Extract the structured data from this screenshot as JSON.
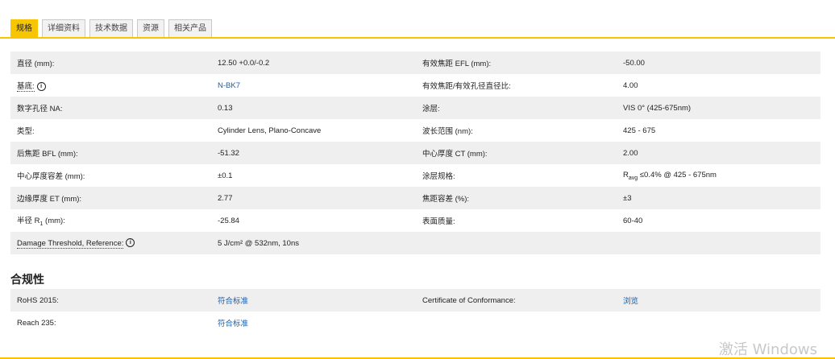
{
  "tabs": [
    "规格",
    "详细资料",
    "技术数据",
    "资源",
    "相关产品"
  ],
  "specs": [
    {
      "l1": "直径 (mm):",
      "v1": "12.50 +0.0/-0.2",
      "l2": "有效焦距 EFL (mm):",
      "v2": "-50.00"
    },
    {
      "l1": "基底:",
      "v1": "N-BK7",
      "l2": "有效焦距/有效孔径直径比:",
      "v2": "4.00"
    },
    {
      "l1": "数字孔径 NA:",
      "v1": "0.13",
      "l2": "涂层:",
      "v2": "VIS 0° (425-675nm)"
    },
    {
      "l1": "类型:",
      "v1": "Cylinder Lens, Plano-Concave",
      "l2": "波长范围 (nm):",
      "v2": "425 - 675"
    },
    {
      "l1": "后焦距 BFL (mm):",
      "v1": "-51.32",
      "l2": "中心厚度 CT (mm):",
      "v2": "2.00"
    },
    {
      "l1": "中心厚度容差 (mm):",
      "v1": "±0.1",
      "l2": "涂层规格:",
      "v2_pre": "R",
      "v2_sub": "avg",
      "v2_post": " ≤0.4% @ 425 - 675nm"
    },
    {
      "l1": "边缘厚度 ET (mm):",
      "v1": "2.77",
      "l2": "焦距容差 (%):",
      "v2": "±3"
    },
    {
      "l1_pre": "半径 R",
      "l1_sub": "1",
      "l1_post": " (mm):",
      "v1": "-25.84",
      "l2": "表面质量:",
      "v2": "60-40"
    },
    {
      "l1": "Damage Threshold, Reference:",
      "v1": "5 J/cm² @ 532nm, 10ns",
      "l2": "",
      "v2": ""
    }
  ],
  "compliance": {
    "title": "合规性",
    "rows": [
      {
        "l1": "RoHS 2015:",
        "v1": "符合标准",
        "l2": "Certificate of Conformance:",
        "v2": "浏览"
      },
      {
        "l1": "Reach 235:",
        "v1": "符合标准",
        "l2": "",
        "v2": ""
      }
    ]
  },
  "info_icon_glyph": "i",
  "watermark": "激活 Windows",
  "colors": {
    "accent": "#f7c600",
    "link": "#1a5ea8",
    "row_shade": "#efefef"
  }
}
